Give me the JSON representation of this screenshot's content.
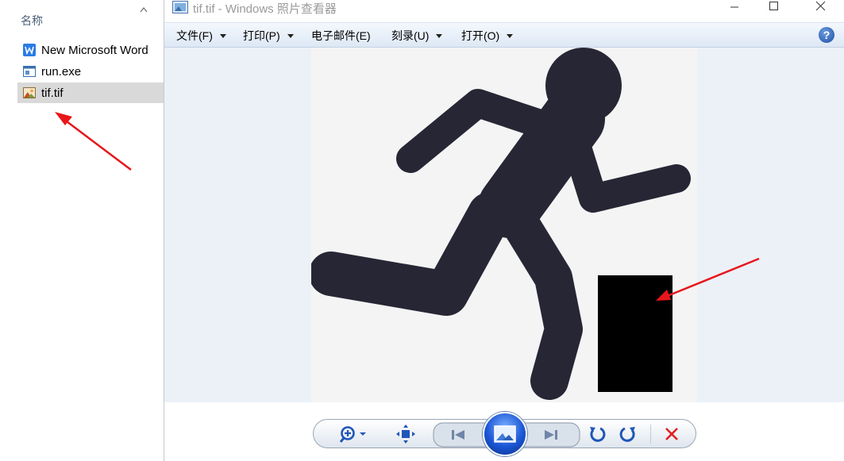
{
  "explorer": {
    "column_header": "名称",
    "files": [
      {
        "name": "New Microsoft Word",
        "icon": "word-doc-icon",
        "selected": false
      },
      {
        "name": "run.exe",
        "icon": "exe-icon",
        "selected": false
      },
      {
        "name": "tif.tif",
        "icon": "image-file-icon",
        "selected": true
      }
    ]
  },
  "viewer": {
    "title": "tif.tif - Windows 照片查看器",
    "menu": [
      {
        "label": "文件(F)",
        "has_caret": true
      },
      {
        "label": "打印(P)",
        "has_caret": true
      },
      {
        "label": "电子邮件(E)",
        "has_caret": false
      },
      {
        "label": "刻录(U)",
        "has_caret": true
      },
      {
        "label": "打开(O)",
        "has_caret": true
      }
    ],
    "help_label": "?",
    "image_description_icon": "running-person-icon",
    "controls": [
      "zoom-icon",
      "actual-size-icon",
      "previous-icon",
      "slideshow-icon",
      "next-icon",
      "rotate-counterclockwise-icon",
      "rotate-clockwise-icon",
      "delete-icon"
    ]
  },
  "colors": {
    "figure": "#272635",
    "arrow": "#e8161b",
    "delete": "#e02020",
    "accent_blue": "#1a56d6"
  }
}
